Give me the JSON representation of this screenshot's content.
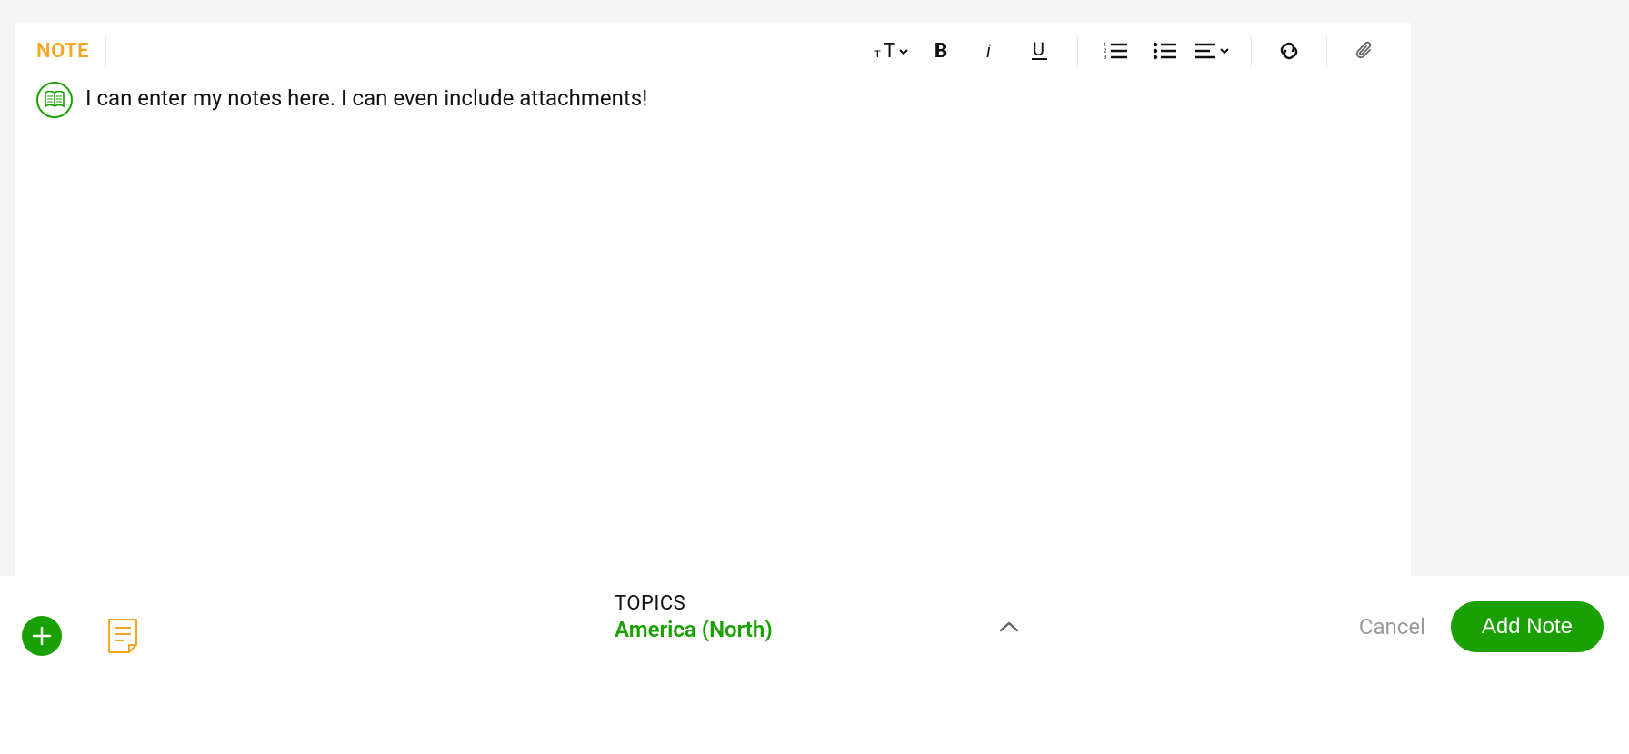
{
  "editor": {
    "tab_label": "NOTE",
    "content": "I can enter my notes here. I can even include attachments!",
    "toolbar": {
      "text_size": "text-size",
      "bold": "bold",
      "italic": "italic",
      "underline": "underline",
      "numbered_list": "numbered-list",
      "bulleted_list": "bulleted-list",
      "align": "align",
      "link": "link",
      "attachment": "attachment"
    }
  },
  "footer": {
    "topics_label": "TOPICS",
    "topics_value": "America (North)",
    "cancel_label": "Cancel",
    "add_label": "Add Note"
  }
}
